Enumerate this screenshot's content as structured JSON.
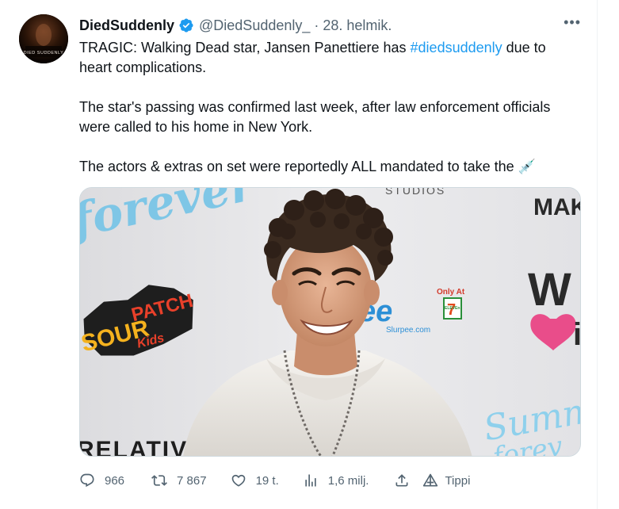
{
  "author": {
    "display_name": "DiedSuddenly",
    "handle": "@DiedSuddenly_",
    "separator": "·",
    "date": "28. helmik.",
    "verified": true,
    "avatar_caption": "DIED SUDDENLY"
  },
  "more_label": "•••",
  "tweet": {
    "p1_before": "TRAGIC: Walking Dead star, Jansen Panettiere has ",
    "hashtag": "#diedsuddenly",
    "p1_after": " due to heart complications.",
    "p2": "The star's passing was confirmed last week, after law enforcement officials were called to his home in New York.",
    "p3": "The actors & extras on set were reportedly ALL mandated to take the ",
    "emoji": "💉"
  },
  "media": {
    "backdrop_texts": {
      "forever": "forever",
      "studios": "STUDIOS",
      "mak": "MAK",
      "sour": "SOUR",
      "patch": "PATCH",
      "kids": "Kids",
      "slurpee": "ee",
      "slurpee_url": "Slurpee.com",
      "only_at": "Only At",
      "seven": "7",
      "eleven": "ELEVEn",
      "w": "W",
      "i": "i",
      "relativity": "RELATIV",
      "summer": "Summ",
      "forever2": "forev"
    }
  },
  "actions": {
    "replies": "966",
    "retweets": "7 867",
    "likes": "19 t.",
    "views": "1,6 milj.",
    "tip_label": "Tippi"
  },
  "colors": {
    "text": "#0f1419",
    "secondary": "#536471",
    "link": "#1d9bf0",
    "verified": "#1d9bf0"
  }
}
